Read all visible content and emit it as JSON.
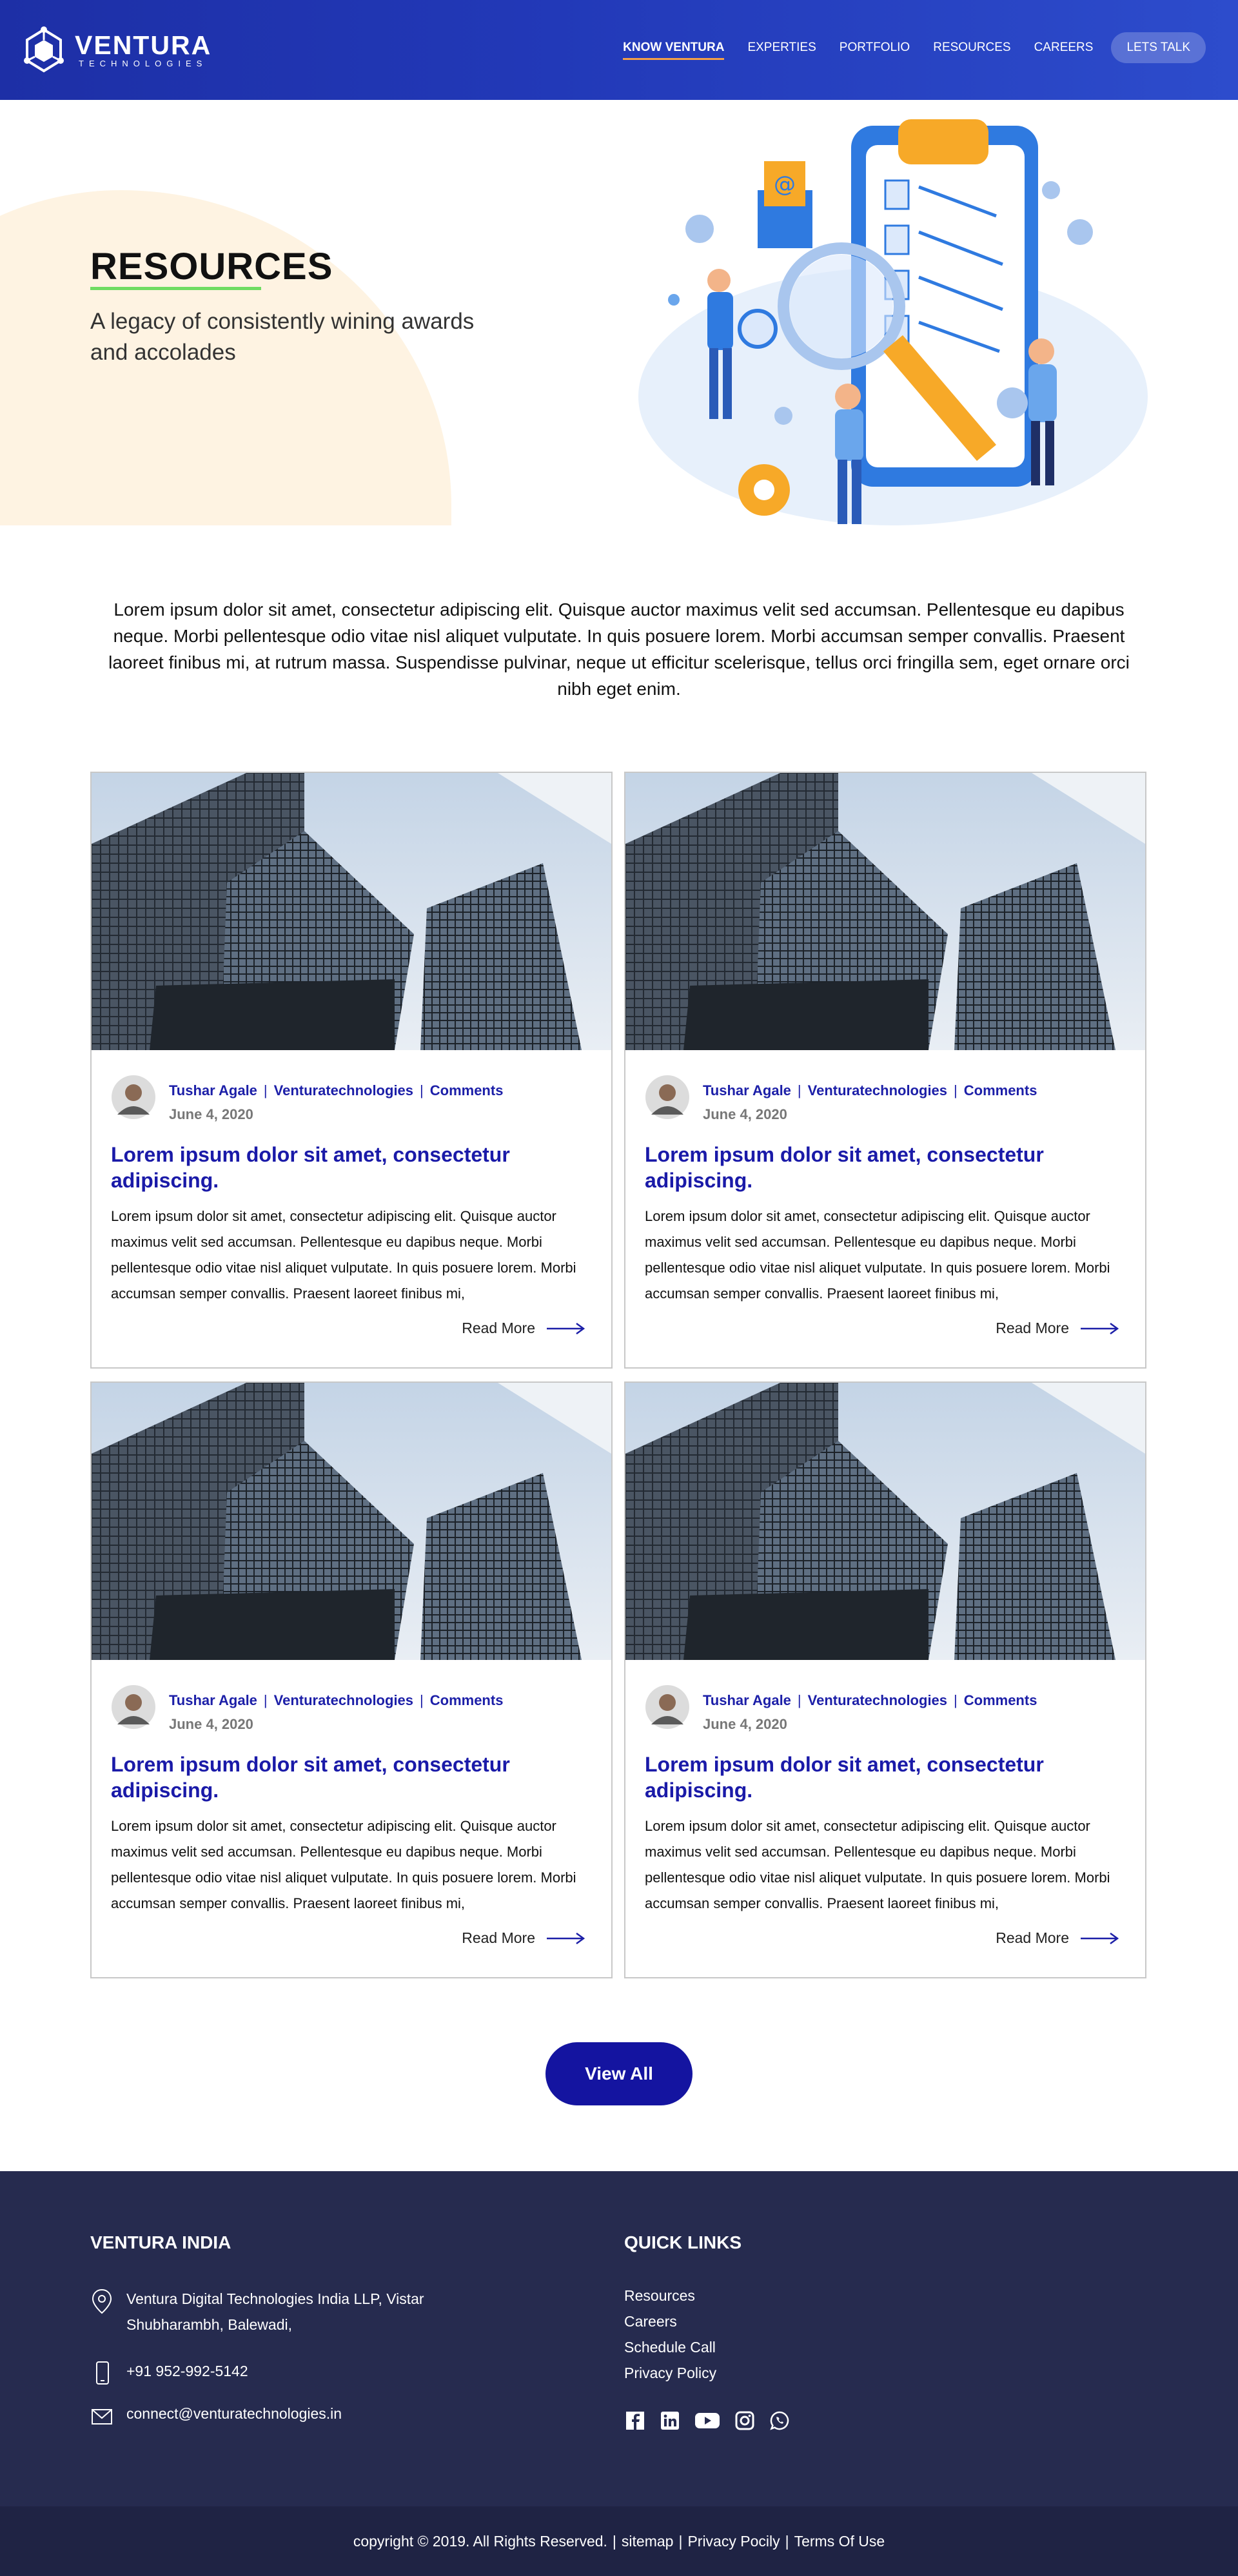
{
  "brand": {
    "name": "VENTURA",
    "tagline": "TECHNOLOGIES"
  },
  "nav": {
    "items": [
      {
        "label": "KNOW VENTURA",
        "active": true
      },
      {
        "label": "EXPERTIES",
        "active": false
      },
      {
        "label": "PORTFOLIO",
        "active": false
      },
      {
        "label": "RESOURCES",
        "active": false
      },
      {
        "label": "CAREERS",
        "active": false
      }
    ],
    "cta": "LETS TALK"
  },
  "hero": {
    "title": "RESOURCES",
    "subtitle": "A legacy of consistently wining awards and accolades"
  },
  "intro": {
    "text": "Lorem ipsum dolor sit amet, consectetur adipiscing elit. Quisque auctor maximus velit sed accumsan. Pellentesque eu dapibus neque. Morbi pellentesque odio vitae nisl aliquet vulputate. In quis posuere lorem. Morbi accumsan semper convallis. Praesent laoreet finibus mi, at rutrum massa. Suspendisse pulvinar, neque ut efficitur scelerisque, tellus orci fringilla sem, eget ornare orci nibh eget enim."
  },
  "posts": [
    {
      "author": "Tushar Agale",
      "category": "Venturatechnologies",
      "comments": "Comments",
      "date": "June 4, 2020",
      "title": "Lorem ipsum dolor sit amet, consectetur adipiscing.",
      "excerpt": "Lorem ipsum dolor sit amet, consectetur adipiscing elit. Quisque auctor maximus velit sed accumsan. Pellentesque eu dapibus neque. Morbi pellentesque odio vitae nisl aliquet vulputate. In quis posuere lorem. Morbi accumsan semper convallis. Praesent laoreet finibus mi,",
      "more": "Read More"
    },
    {
      "author": "Tushar Agale",
      "category": "Venturatechnologies",
      "comments": "Comments",
      "date": "June 4, 2020",
      "title": "Lorem ipsum dolor sit amet, consectetur adipiscing.",
      "excerpt": "Lorem ipsum dolor sit amet, consectetur adipiscing elit. Quisque auctor maximus velit sed accumsan. Pellentesque eu dapibus neque. Morbi pellentesque odio vitae nisl aliquet vulputate. In quis posuere lorem. Morbi accumsan semper convallis. Praesent laoreet finibus mi,",
      "more": "Read More"
    },
    {
      "author": "Tushar Agale",
      "category": "Venturatechnologies",
      "comments": "Comments",
      "date": "June 4, 2020",
      "title": "Lorem ipsum dolor sit amet, consectetur adipiscing.",
      "excerpt": "Lorem ipsum dolor sit amet, consectetur adipiscing elit. Quisque auctor maximus velit sed accumsan. Pellentesque eu dapibus neque. Morbi pellentesque odio vitae nisl aliquet vulputate. In quis posuere lorem. Morbi accumsan semper convallis. Praesent laoreet finibus mi,",
      "more": "Read More"
    },
    {
      "author": "Tushar Agale",
      "category": "Venturatechnologies",
      "comments": "Comments",
      "date": "June 4, 2020",
      "title": "Lorem ipsum dolor sit amet, consectetur adipiscing.",
      "excerpt": "Lorem ipsum dolor sit amet, consectetur adipiscing elit. Quisque auctor maximus velit sed accumsan. Pellentesque eu dapibus neque. Morbi pellentesque odio vitae nisl aliquet vulputate. In quis posuere lorem. Morbi accumsan semper convallis. Praesent laoreet finibus mi,",
      "more": "Read More"
    }
  ],
  "view_all": "View All",
  "footer": {
    "office_heading": "VENTURA INDIA",
    "address": "Ventura Digital Technologies India LLP, Vistar Shubharambh, Balewadi,",
    "phone": "+91 952-992-5142",
    "email": "connect@venturatechnologies.in",
    "links_heading": "QUICK LINKS",
    "links": [
      "Resources",
      "Careers",
      "Schedule Call",
      "Privacy Policy"
    ],
    "social": [
      "facebook-icon",
      "linkedin-icon",
      "youtube-icon",
      "instagram-icon",
      "whatsapp-icon"
    ]
  },
  "bottom": {
    "copyright": "copyright © 2019. All Rights Reserved.",
    "sitemap": "sitemap",
    "privacy": "Privacy Pocily",
    "terms": "Terms Of Use"
  },
  "colors": {
    "header_start": "#1d2fa6",
    "header_end": "#2d4ccc",
    "accent_blue": "#1414a0",
    "title_blue": "#1a1aa8",
    "underline_green": "#6fdc62",
    "footer_bg": "#262b4f"
  }
}
